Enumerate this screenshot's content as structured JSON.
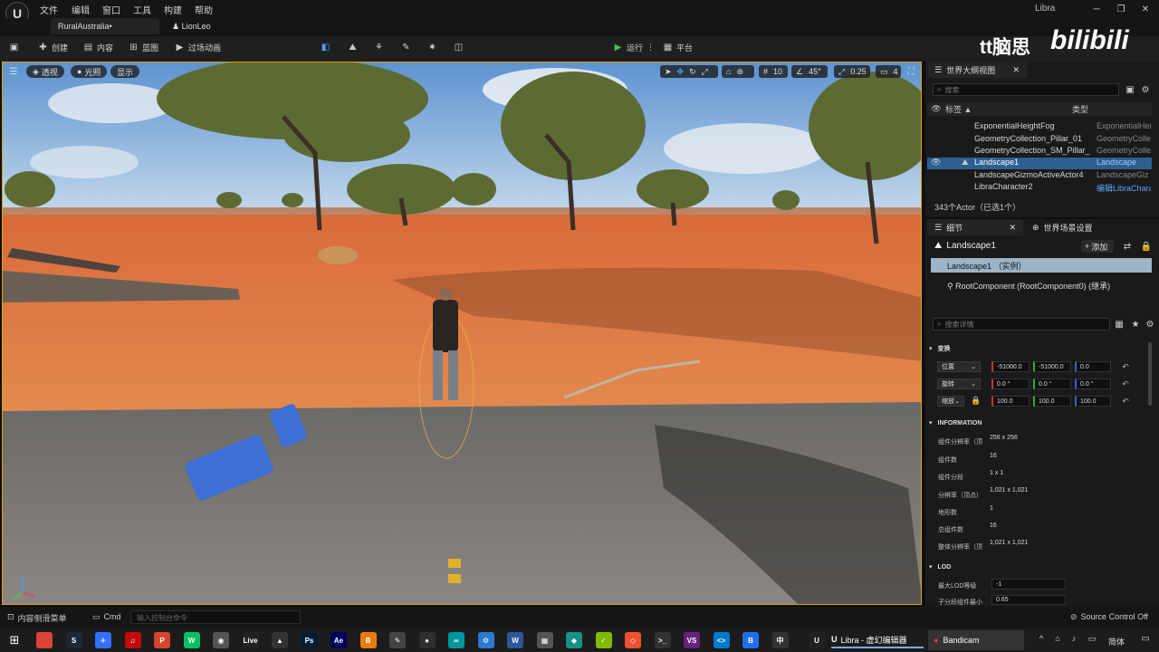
{
  "titlebar": {
    "logo_glyph": "U",
    "menus": [
      "文件",
      "编辑",
      "窗口",
      "工具",
      "构建",
      "帮助"
    ],
    "app_name": "Libra"
  },
  "tabs": [
    {
      "label": "RuralAustralia•"
    },
    {
      "label": "LionLeo"
    }
  ],
  "toolbar": {
    "create": "创建",
    "content": "内容",
    "blueprint": "蓝图",
    "cinematics": "过场动画",
    "run": "运行",
    "platform": "平台"
  },
  "watermark": {
    "channel": "tt脑思",
    "site": "bilibili"
  },
  "viewport": {
    "perspective": "透视",
    "lit": "光照",
    "show": "显示",
    "grid": "10",
    "angle": "45°",
    "scale": "0.25",
    "cams": "4"
  },
  "outliner": {
    "title": "世界大纲视图",
    "search_placeholder": "搜索",
    "col_label": "标签 ▲",
    "col_type": "类型",
    "rows": [
      {
        "name": "ExponentialHeightFog",
        "type": "ExponentialHei"
      },
      {
        "name": "GeometryCollection_Pillar_01",
        "type": "GeometryColle"
      },
      {
        "name": "GeometryCollection_SM_Pillar_",
        "type": "GeometryColle"
      },
      {
        "name": "Landscape1",
        "type": "Landscape"
      },
      {
        "name": "LandscapeGizmoActiveActor4",
        "type": "LandscapeGiz"
      },
      {
        "name": "LibraCharacter2",
        "type": "编辑LibraChara"
      }
    ],
    "count": "343个Actor（已选1个）"
  },
  "details": {
    "tab_details": "细节",
    "tab_world": "世界场景设置",
    "object": "Landscape1",
    "add": "添加",
    "instance": "Landscape1 （实例）",
    "root": "RootComponent (RootComponent0) (继承)",
    "search_placeholder": "搜索详情",
    "transform": "变换",
    "location": "位置",
    "rotation": "旋转",
    "scale": "缩放",
    "loc": [
      "-51000.0",
      "-51000.0",
      "0.0"
    ],
    "rot": [
      "0.0 °",
      "0.0 °",
      "0.0 °"
    ],
    "scl": [
      "100.0",
      "100.0",
      "100.0"
    ],
    "information": "INFORMATION",
    "info": [
      {
        "label": "组件分辨率（顶",
        "value": "256 x 256"
      },
      {
        "label": "组件数",
        "value": "16"
      },
      {
        "label": "组件分段",
        "value": "1 x 1"
      },
      {
        "label": "分辨率（顶点）",
        "value": "1,021 x 1,021"
      },
      {
        "label": "地形数",
        "value": "1"
      },
      {
        "label": "总组件数",
        "value": "16"
      },
      {
        "label": "整体分辨率（顶",
        "value": "1,021 x 1,021"
      }
    ],
    "lod": "LOD",
    "max_lod_label": "最大LOD等级",
    "max_lod_value": "-1",
    "sub_label": "子分段组件最小",
    "sub_value": "0.65"
  },
  "statusbar": {
    "drawer": "内容侧滑菜单",
    "cmd": "Cmd",
    "cmd_placeholder": "输入控制台命令",
    "source_control": "Source Control Off"
  },
  "taskbar": {
    "ue_window": "Libra - 虚幻编辑器",
    "bandicam": "Bandicam",
    "ime": "简体",
    "apps": [
      {
        "name": "chrome",
        "glyph": "",
        "color": "#db4437"
      },
      {
        "name": "steam",
        "glyph": "S",
        "color": "#1b2838"
      },
      {
        "name": "feishu",
        "glyph": "✈",
        "color": "#3370ff"
      },
      {
        "name": "netease",
        "glyph": "♫",
        "color": "#c20c0c"
      },
      {
        "name": "wps",
        "glyph": "P",
        "color": "#d4452f"
      },
      {
        "name": "wechat",
        "glyph": "W",
        "color": "#07c160"
      },
      {
        "name": "camera",
        "glyph": "◉",
        "color": "#555"
      },
      {
        "name": "live",
        "glyph": "Live",
        "color": "#222"
      },
      {
        "name": "unity",
        "glyph": "▲",
        "color": "#333"
      },
      {
        "name": "ps",
        "glyph": "Ps",
        "color": "#001e36"
      },
      {
        "name": "ae",
        "glyph": "Ae",
        "color": "#00005b"
      },
      {
        "name": "blender",
        "glyph": "B",
        "color": "#e87d0d"
      },
      {
        "name": "inkscape",
        "glyph": "✎",
        "color": "#444"
      },
      {
        "name": "obs",
        "glyph": "●",
        "color": "#302e31"
      },
      {
        "name": "arduino",
        "glyph": "∞",
        "color": "#00979d"
      },
      {
        "name": "network",
        "glyph": "⚙",
        "color": "#2b79d0"
      },
      {
        "name": "word",
        "glyph": "W",
        "color": "#2b579a"
      },
      {
        "name": "calc",
        "glyph": "▦",
        "color": "#555"
      },
      {
        "name": "gitkraken",
        "glyph": "◆",
        "color": "#179287"
      },
      {
        "name": "note",
        "glyph": "✓",
        "color": "#7fba00"
      },
      {
        "name": "git",
        "glyph": "◇",
        "color": "#f05033"
      },
      {
        "name": "terminal",
        "glyph": ">_",
        "color": "#333"
      },
      {
        "name": "vs",
        "glyph": "VS",
        "color": "#68217a"
      },
      {
        "name": "vscode",
        "glyph": "<>",
        "color": "#007acc"
      },
      {
        "name": "bear",
        "glyph": "B",
        "color": "#1f6feb"
      },
      {
        "name": "ime",
        "glyph": "中",
        "color": "#333"
      },
      {
        "name": "ue",
        "glyph": "U",
        "color": "#222"
      }
    ]
  },
  "colors": {
    "accent": "#e0a200",
    "play_green": "#4fc24f",
    "selected_row": "#2d5f8f",
    "instance_bg": "#9bb4c8"
  }
}
